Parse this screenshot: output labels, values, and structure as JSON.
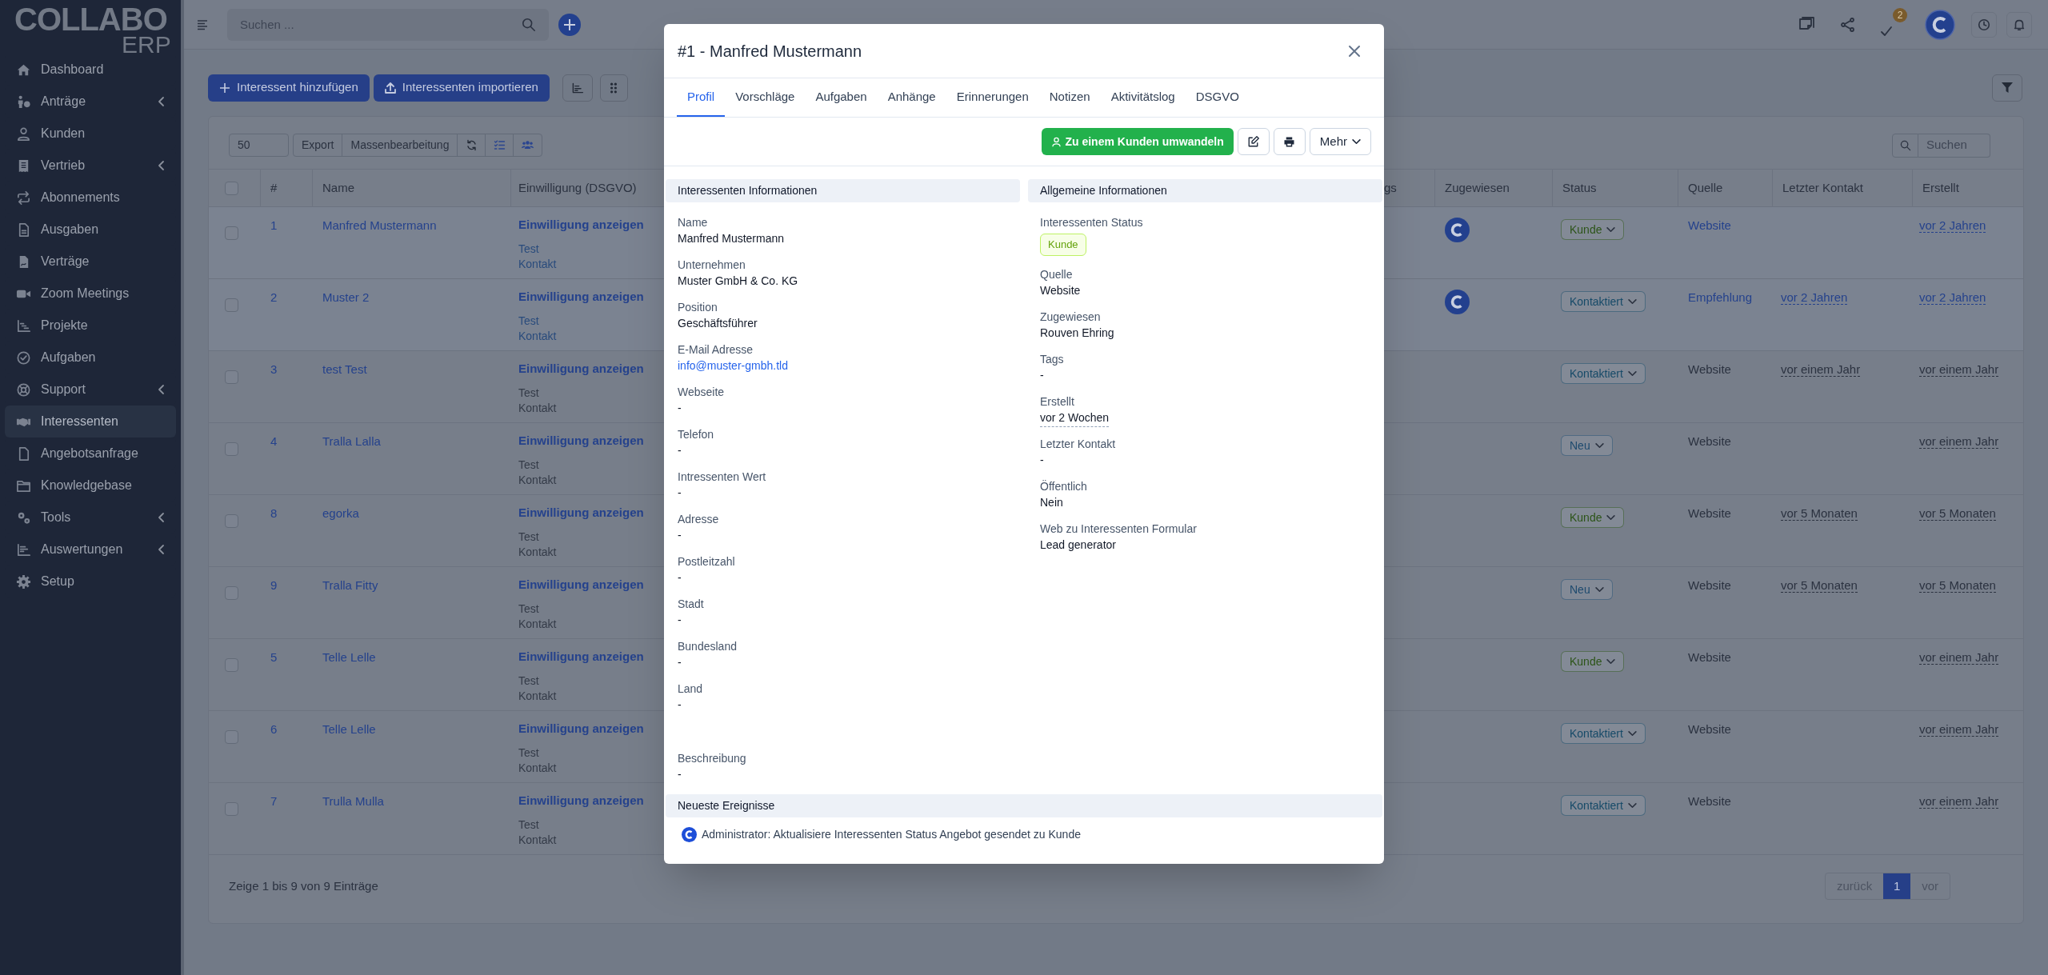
{
  "logo": {
    "title": "COLLABO",
    "subtitle": "ERP"
  },
  "sidebar": {
    "items": [
      {
        "label": "Dashboard",
        "selected": false,
        "expandable": false
      },
      {
        "label": "Anträge",
        "selected": false,
        "expandable": true
      },
      {
        "label": "Kunden",
        "selected": false,
        "expandable": false
      },
      {
        "label": "Vertrieb",
        "selected": false,
        "expandable": true
      },
      {
        "label": "Abonnements",
        "selected": false,
        "expandable": false
      },
      {
        "label": "Ausgaben",
        "selected": false,
        "expandable": false
      },
      {
        "label": "Verträge",
        "selected": false,
        "expandable": false
      },
      {
        "label": "Zoom Meetings",
        "selected": false,
        "expandable": false
      },
      {
        "label": "Projekte",
        "selected": false,
        "expandable": false
      },
      {
        "label": "Aufgaben",
        "selected": false,
        "expandable": false
      },
      {
        "label": "Support",
        "selected": false,
        "expandable": true
      },
      {
        "label": "Interessenten",
        "selected": true,
        "expandable": false
      },
      {
        "label": "Angebotsanfrage",
        "selected": false,
        "expandable": false
      },
      {
        "label": "Knowledgebase",
        "selected": false,
        "expandable": false
      },
      {
        "label": "Tools",
        "selected": false,
        "expandable": true
      },
      {
        "label": "Auswertungen",
        "selected": false,
        "expandable": true
      },
      {
        "label": "Setup",
        "selected": false,
        "expandable": false
      }
    ]
  },
  "topbar": {
    "search": {
      "placeholder": "Suchen ..."
    },
    "tasks_badge": "2"
  },
  "toolbar": {
    "buttons": [
      "Interessent hinzufügen",
      "Interessenten importieren"
    ]
  },
  "table": {
    "page_size": "50",
    "buttons": [
      "Export",
      "Massenbearbeitung"
    ],
    "search": {
      "placeholder": "Suchen"
    },
    "select_all": {
      "checked": false
    },
    "columns": [
      "#",
      "Name",
      "Einwilligung (DSGVO)",
      "gs",
      "Zugewiesen",
      "Status",
      "Quelle",
      "Letzter Kontakt",
      "Erstellt"
    ],
    "rows": [
      {
        "checked": false,
        "highlighted": true,
        "number": "1",
        "name": "Manfred Mustermann",
        "consent": "Einwilligung anzeigen",
        "consent_lines": [
          "Test",
          "Kontakt"
        ],
        "assigned": true,
        "status": {
          "label": "Kunde",
          "color": "#2c5418"
        },
        "source": "Website",
        "created": "vor 2 Jahren"
      },
      {
        "checked": false,
        "highlighted": true,
        "number": "2",
        "name": "Muster 2",
        "consent": "Einwilligung anzeigen",
        "consent_lines": [
          "Test",
          "Kontakt"
        ],
        "assigned": true,
        "status": {
          "label": "Kontaktiert",
          "color": "#164a68"
        },
        "source": "Empfehlung",
        "last_contact": "vor 2 Jahren",
        "created": "vor 2 Jahren"
      },
      {
        "checked": false,
        "highlighted": false,
        "number": "3",
        "name": "test Test",
        "consent": "Einwilligung anzeigen",
        "consent_lines": [
          "Test",
          "Kontakt"
        ],
        "assigned": false,
        "status": {
          "label": "Kontaktiert",
          "color": "#164a68"
        },
        "source": "Website",
        "last_contact": "vor einem Jahr",
        "created": "vor einem Jahr"
      },
      {
        "checked": false,
        "highlighted": false,
        "number": "4",
        "name": "Tralla Lalla",
        "consent": "Einwilligung anzeigen",
        "consent_lines": [
          "Test",
          "Kontakt"
        ],
        "assigned": false,
        "status": {
          "label": "Neu",
          "color": "#1d4a6e"
        },
        "source": "Website",
        "created": "vor einem Jahr"
      },
      {
        "checked": false,
        "highlighted": false,
        "number": "8",
        "name": "egorka",
        "consent": "Einwilligung anzeigen",
        "consent_lines": [
          "Test",
          "Kontakt"
        ],
        "assigned": false,
        "status": {
          "label": "Kunde",
          "color": "#2c5418"
        },
        "source": "Website",
        "last_contact": "vor 5 Monaten",
        "created": "vor 5 Monaten"
      },
      {
        "checked": false,
        "highlighted": false,
        "number": "9",
        "name": "Tralla Fitty",
        "consent": "Einwilligung anzeigen",
        "consent_lines": [
          "Test",
          "Kontakt"
        ],
        "assigned": false,
        "status": {
          "label": "Neu",
          "color": "#1d4a6e"
        },
        "source": "Website",
        "last_contact": "vor 5 Monaten",
        "created": "vor 5 Monaten"
      },
      {
        "checked": false,
        "highlighted": false,
        "number": "5",
        "name": "Telle Lelle",
        "consent": "Einwilligung anzeigen",
        "consent_lines": [
          "Test",
          "Kontakt"
        ],
        "assigned": false,
        "status": {
          "label": "Kunde",
          "color": "#2c5418"
        },
        "source": "Website",
        "created": "vor einem Jahr"
      },
      {
        "checked": false,
        "highlighted": false,
        "number": "6",
        "name": "Telle Lelle",
        "consent": "Einwilligung anzeigen",
        "consent_lines": [
          "Test",
          "Kontakt"
        ],
        "assigned": false,
        "status": {
          "label": "Kontaktiert",
          "color": "#164a68"
        },
        "source": "Website",
        "created": "vor einem Jahr"
      },
      {
        "checked": false,
        "highlighted": false,
        "number": "7",
        "name": "Trulla Mulla",
        "consent": "Einwilligung anzeigen",
        "consent_lines": [
          "Test",
          "Kontakt"
        ],
        "assigned": false,
        "status": {
          "label": "Kontaktiert",
          "color": "#164a68"
        },
        "source": "Website",
        "created": "vor einem Jahr"
      }
    ],
    "summary": "Zeige 1 bis 9 von 9 Einträge",
    "pagination": {
      "previous": "zurück",
      "pages": [
        {
          "label": "1",
          "selected": true
        }
      ],
      "next": "vor"
    }
  },
  "modal": {
    "title": "#1 - Manfred Mustermann",
    "tabs": [
      {
        "label": "Profil",
        "selected": true
      },
      {
        "label": "Vorschläge",
        "selected": false
      },
      {
        "label": "Aufgaben",
        "selected": false
      },
      {
        "label": "Anhänge",
        "selected": false
      },
      {
        "label": "Erinnerungen",
        "selected": false
      },
      {
        "label": "Notizen",
        "selected": false
      },
      {
        "label": "Aktivitätslog",
        "selected": false
      },
      {
        "label": "DSGVO",
        "selected": false
      }
    ],
    "convert_button": "Zu einem Kunden umwandeln",
    "more_button": "Mehr",
    "left": {
      "heading": "Interessenten Informationen",
      "fields": [
        {
          "kind": "text",
          "label": "Name",
          "value": "Manfred Mustermann"
        },
        {
          "kind": "text",
          "label": "Unternehmen",
          "value": "Muster GmbH & Co. KG"
        },
        {
          "kind": "text",
          "label": "Position",
          "value": "Geschäftsführer"
        },
        {
          "kind": "link",
          "label": "E-Mail Adresse",
          "value": "info@muster-gmbh.tld"
        },
        {
          "kind": "text",
          "label": "Webseite",
          "value": "-"
        },
        {
          "kind": "text",
          "label": "Telefon",
          "value": "-"
        },
        {
          "kind": "text",
          "label": "Intressenten Wert",
          "value": "-"
        },
        {
          "kind": "text",
          "label": "Adresse",
          "value": "-"
        },
        {
          "kind": "text",
          "label": "Postleitzahl",
          "value": "-"
        },
        {
          "kind": "text",
          "label": "Stadt",
          "value": "-"
        },
        {
          "kind": "text",
          "label": "Bundesland",
          "value": "-"
        },
        {
          "kind": "text",
          "label": "Land",
          "value": "-"
        }
      ],
      "description": {
        "label": "Beschreibung",
        "value": "-"
      }
    },
    "right": {
      "heading": "Allgemeine Informationen",
      "fields": [
        {
          "kind": "badge",
          "label": "Interessenten Status",
          "value": "Kunde"
        },
        {
          "kind": "text",
          "label": "Quelle",
          "value": "Website"
        },
        {
          "kind": "text",
          "label": "Zugewiesen",
          "value": "Rouven Ehring"
        },
        {
          "kind": "text",
          "label": "Tags",
          "value": "-"
        },
        {
          "kind": "time",
          "label": "Erstellt",
          "value": "vor 2 Wochen"
        },
        {
          "kind": "text",
          "label": "Letzter Kontakt",
          "value": "-"
        },
        {
          "kind": "text",
          "label": "Öffentlich",
          "value": "Nein"
        },
        {
          "kind": "text",
          "label": "Web zu Interessenten Formular",
          "value": "Lead generator"
        }
      ]
    },
    "events": {
      "heading": "Neueste Ereignisse",
      "items": [
        "Administrator: Aktualisiere Interessenten Status Angebot gesendet zu Kunde"
      ]
    }
  }
}
